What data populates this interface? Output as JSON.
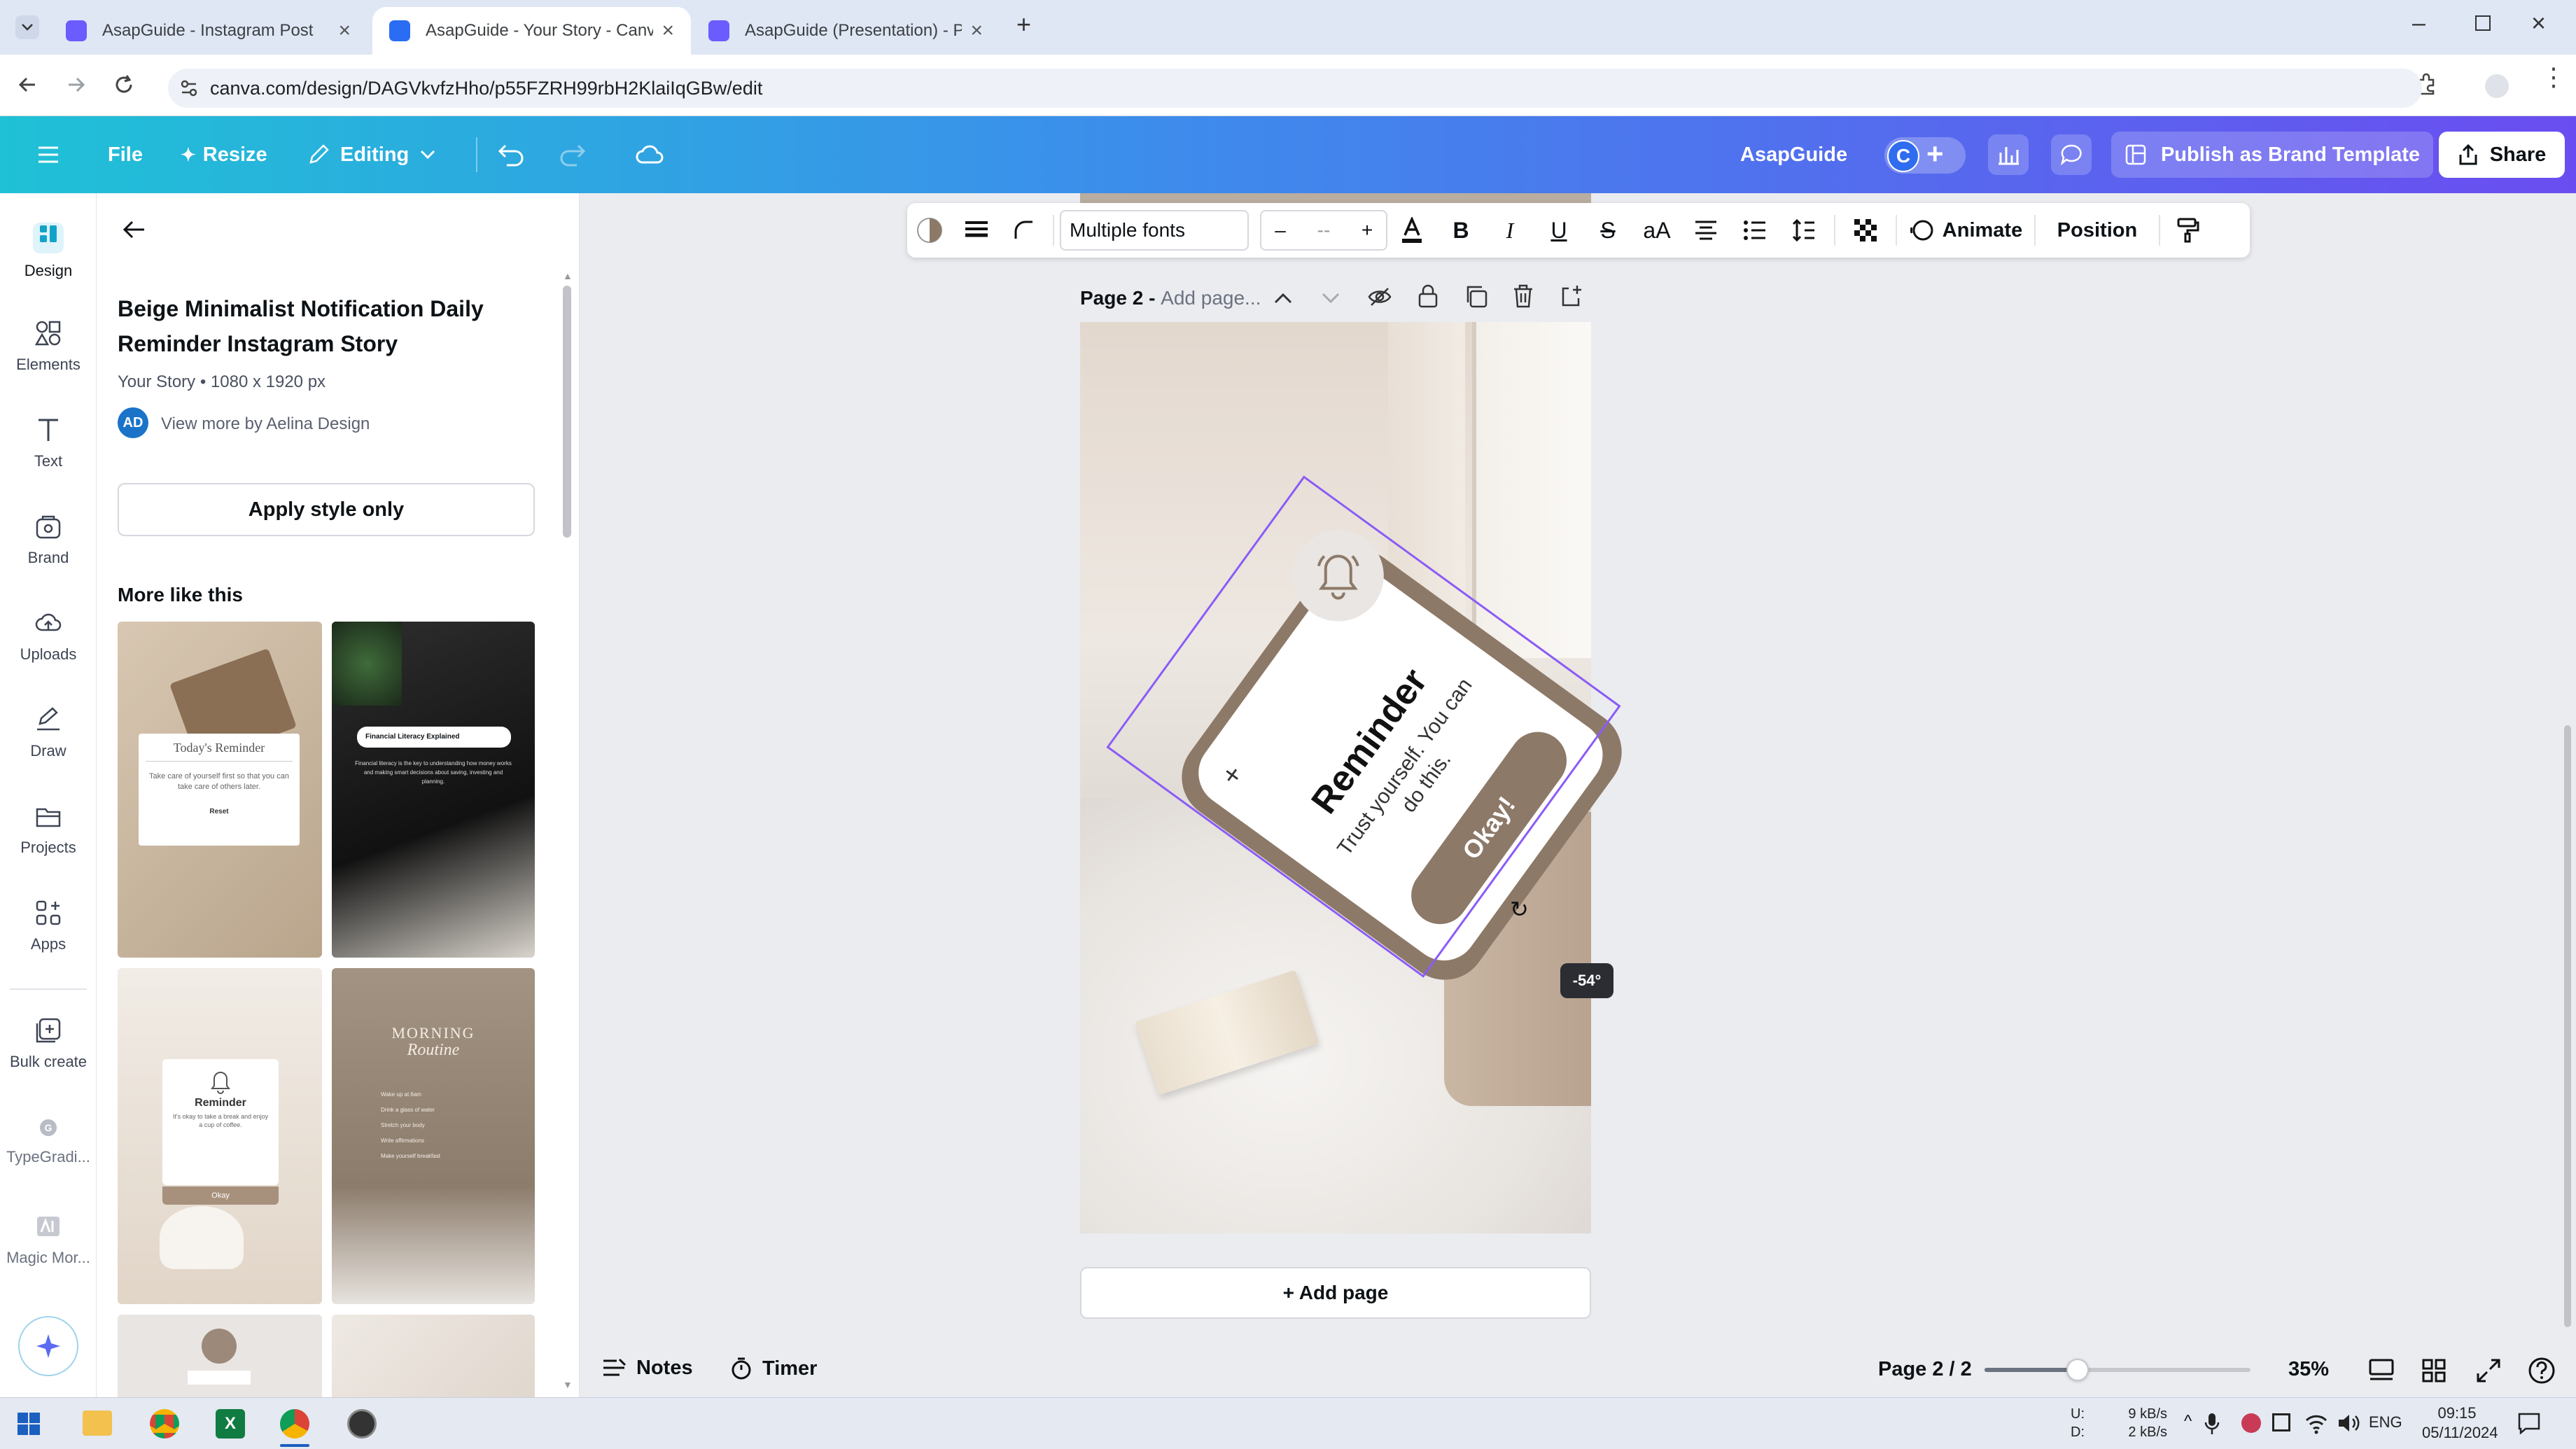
{
  "browser": {
    "tabs": [
      {
        "title": "AsapGuide - Instagram Post",
        "active": false
      },
      {
        "title": "AsapGuide - Your Story - Canva",
        "active": true
      },
      {
        "title": "AsapGuide (Presentation) - Pre",
        "active": false
      }
    ],
    "url": "canva.com/design/DAGVkvfzHho/p55FZRH99rbH2KlaiIqGBw/edit"
  },
  "header": {
    "file": "File",
    "resize": "Resize",
    "editing": "Editing",
    "team": "AsapGuide",
    "avatar": "C",
    "publish": "Publish as Brand Template",
    "share": "Share"
  },
  "rail": {
    "items": [
      {
        "label": "Design",
        "icon": "design-icon"
      },
      {
        "label": "Elements",
        "icon": "elements-icon"
      },
      {
        "label": "Text",
        "icon": "text-icon"
      },
      {
        "label": "Brand",
        "icon": "brand-icon"
      },
      {
        "label": "Uploads",
        "icon": "uploads-icon"
      },
      {
        "label": "Draw",
        "icon": "draw-icon"
      },
      {
        "label": "Projects",
        "icon": "projects-icon"
      },
      {
        "label": "Apps",
        "icon": "apps-icon"
      },
      {
        "label": "Bulk create",
        "icon": "bulk-create-icon"
      },
      {
        "label": "TypeGradi...",
        "icon": "typegradient-icon"
      },
      {
        "label": "Magic Mor...",
        "icon": "magic-morph-icon"
      }
    ]
  },
  "panel": {
    "title": "Beige Minimalist Notification Daily Reminder Instagram Story",
    "meta": "Your Story • 1080 x 1920 px",
    "author_initials": "AD",
    "author_link": "View more by Aelina Design",
    "apply_style": "Apply style only",
    "more_like_this": "More like this",
    "thumbs": [
      {
        "heading": "Today's Reminder",
        "body": "Take care of yourself first so that you can take care of others later.",
        "button": "Reset"
      },
      {
        "heading": "Financial Literacy Explained",
        "body": "Financial literacy is the key to understanding how money works and making smart decisions about saving, investing and planning."
      },
      {
        "heading": "Reminder",
        "body": "It's okay to take a break and enjoy a cup of coffee.",
        "button": "Okay"
      },
      {
        "heading": "MORNING",
        "script": "Routine",
        "items": [
          "Wake up at 6am",
          "Drink a glass of water",
          "Stretch your body",
          "Write affirmations",
          "Make yourself breakfast"
        ]
      }
    ]
  },
  "format_toolbar": {
    "font": "Multiple fonts",
    "size_minus": "–",
    "size_value": "--",
    "size_plus": "+",
    "animate": "Animate",
    "position": "Position"
  },
  "page": {
    "label": "Page 2",
    "title_placeholder": "Add page...",
    "card_title": "Reminder",
    "card_body_line1": "Trust yourself. You can",
    "card_body_line2": "do this.",
    "card_button": "Okay!",
    "rotation_badge": "-54°",
    "add_page": "+ Add page"
  },
  "footer": {
    "notes": "Notes",
    "timer": "Timer",
    "page_count": "Page 2 / 2",
    "zoom": "35%",
    "zoom_fraction": 0.35
  },
  "taskbar": {
    "net_up_label": "U:",
    "net_down_label": "D:",
    "net_up": "9 kB/s",
    "net_down": "2 kB/s",
    "lang": "ENG",
    "time": "09:15",
    "date": "05/11/2024"
  },
  "colors": {
    "accent": "#8b3dff",
    "selection": "#8b5cf6",
    "card_brown": "#8d7968",
    "header_start": "#1fc1d6",
    "header_end": "#6a4df0"
  }
}
